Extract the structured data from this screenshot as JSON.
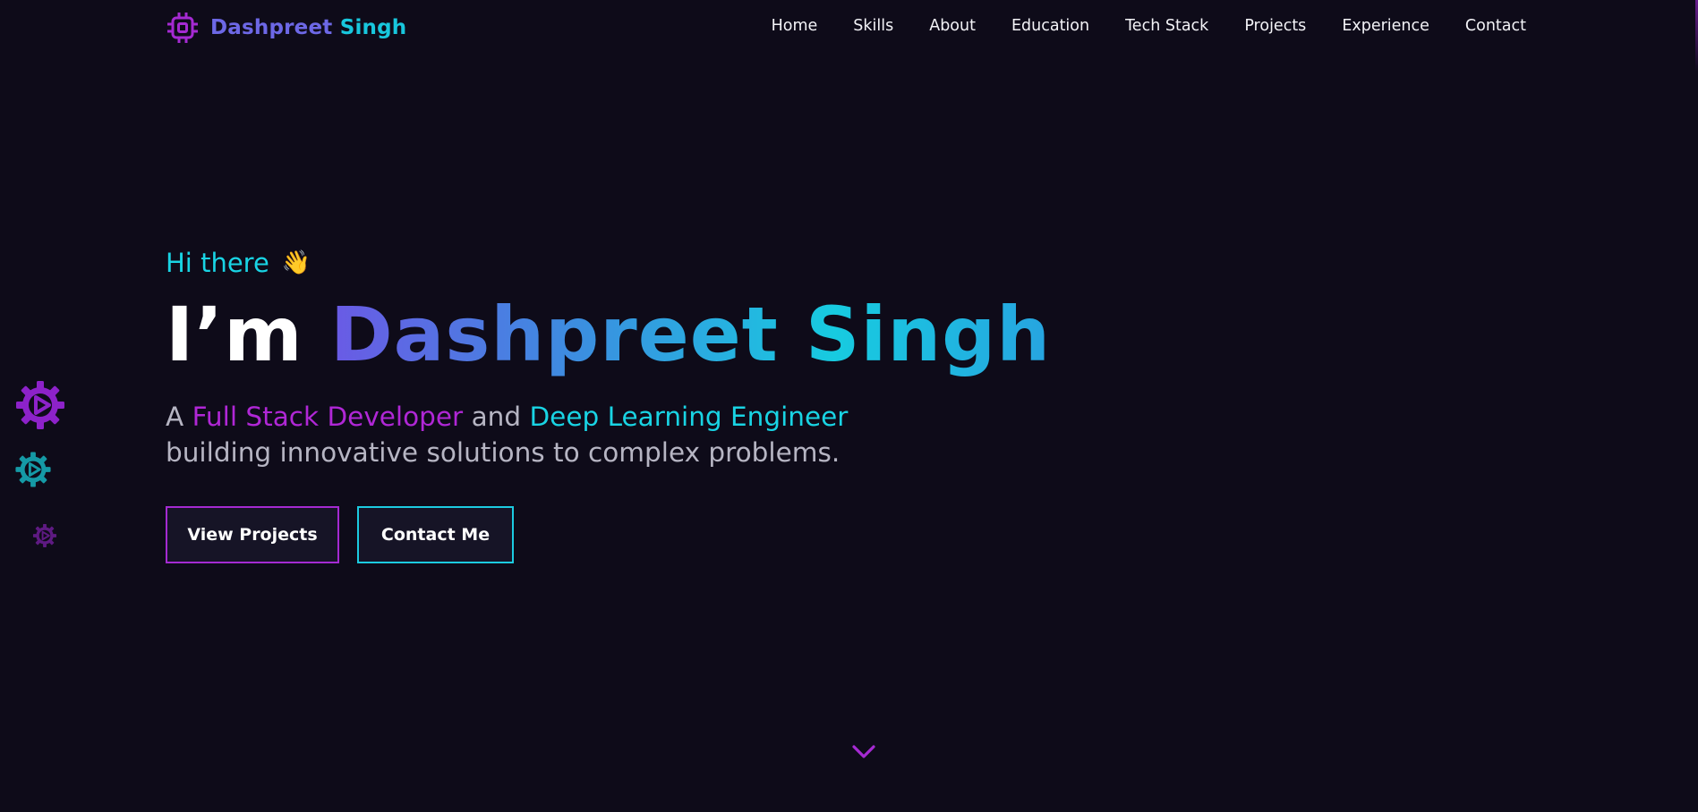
{
  "brand": {
    "first": "Dashpreet",
    "last": "Singh",
    "icon": "chip-icon"
  },
  "nav": {
    "items": [
      "Home",
      "Skills",
      "About",
      "Education",
      "Tech Stack",
      "Projects",
      "Experience",
      "Contact"
    ]
  },
  "hero": {
    "greeting": "Hi there",
    "wave_emoji": "👋",
    "headline_prefix": "I’m",
    "name": "Dashpreet Singh",
    "tagline_prefix": "A",
    "role_1": "Full Stack Developer",
    "connector": "and",
    "role_2": "Deep Learning Engineer",
    "tagline_suffix": "building innovative solutions to complex problems."
  },
  "buttons": {
    "view_projects": "View Projects",
    "contact_me": "Contact Me"
  },
  "decorations": {
    "gears": [
      "gear-icon",
      "gear-icon",
      "gear-icon"
    ],
    "scroll_down": "chevron-down-icon"
  },
  "colors": {
    "background": "#0e0b19",
    "accent_purple": "#a52ad2",
    "accent_cyan": "#19d4e4",
    "brand_indigo": "#6d68e6"
  }
}
